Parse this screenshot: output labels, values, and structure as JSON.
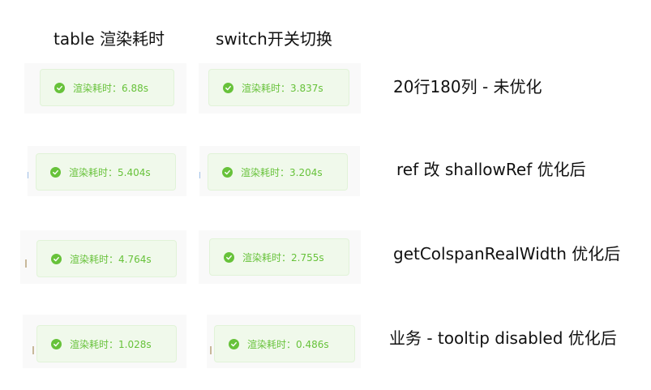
{
  "headers": {
    "col_table": "table 渲染耗时",
    "col_switch": "switch开关切换"
  },
  "rows": [
    {
      "label": "20行180列 - 未优化",
      "table_toast": "渲染耗时：6.88s",
      "switch_toast": "渲染耗时：3.837s"
    },
    {
      "label": "ref 改 shallowRef 优化后",
      "table_toast": "渲染耗时：5.404s",
      "switch_toast": "渲染耗时：3.204s"
    },
    {
      "label": "getColspanRealWidth 优化后",
      "table_toast": "渲染耗时：4.764s",
      "switch_toast": "渲染耗时：2.755s"
    },
    {
      "label": "业务 - tooltip disabled 优化后",
      "table_toast": "渲染耗时：1.028s",
      "switch_toast": "渲染耗时：0.486s"
    }
  ],
  "icons": {
    "toast_icon": "success-check-icon"
  },
  "colors": {
    "success_green": "#67c23a",
    "toast_background": "#f0f9eb",
    "toast_border": "#e1f3d8"
  }
}
